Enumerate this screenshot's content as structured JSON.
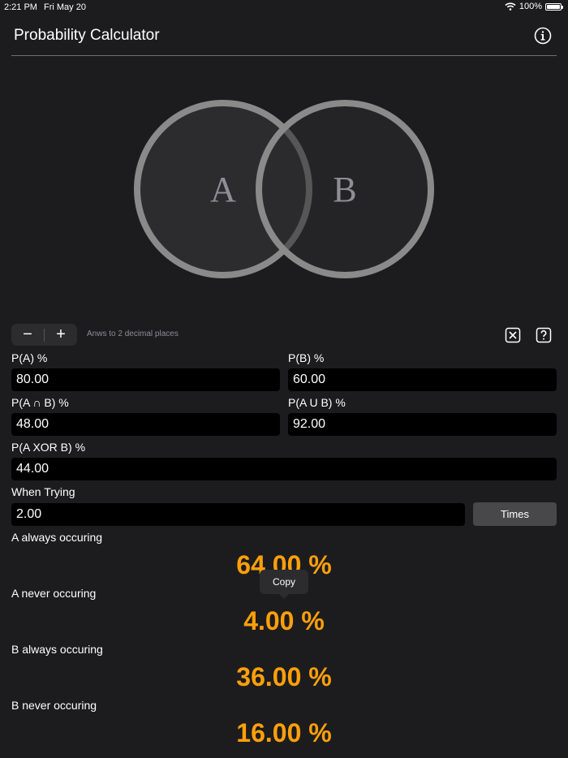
{
  "status": {
    "time": "2:21 PM",
    "date": "Fri May 20",
    "battery": "100%",
    "battery_level": 1.0
  },
  "header": {
    "title": "Probability Calculator"
  },
  "venn": {
    "label_a": "A",
    "label_b": "B"
  },
  "controls": {
    "minus": "−",
    "plus": "+",
    "precision_label": "Anws to 2 decimal places"
  },
  "fields": {
    "pa": {
      "label": "P(A) %",
      "value": "80.00"
    },
    "pb": {
      "label": "P(B) %",
      "value": "60.00"
    },
    "pab": {
      "label": "P(A ∩ B) %",
      "value": "48.00"
    },
    "paub": {
      "label": "P(A U B) %",
      "value": "92.00"
    },
    "pxor": {
      "label": "P(A XOR B) %",
      "value": "44.00"
    },
    "trying": {
      "label": "When Trying",
      "value": "2.00"
    }
  },
  "times_button": "Times",
  "results": {
    "a_always": {
      "label": "A always occuring",
      "value": "64.00 %"
    },
    "a_never": {
      "label": "A never occuring",
      "value": "4.00 %"
    },
    "b_always": {
      "label": "B always occuring",
      "value": "36.00 %"
    },
    "b_never": {
      "label": "B never occuring",
      "value": "16.00 %"
    }
  },
  "tooltip": {
    "label": "Copy"
  },
  "colors": {
    "accent": "#ff9f0a",
    "background": "#1c1c1e",
    "field": "#000000",
    "circle": "#8a8a8a"
  }
}
